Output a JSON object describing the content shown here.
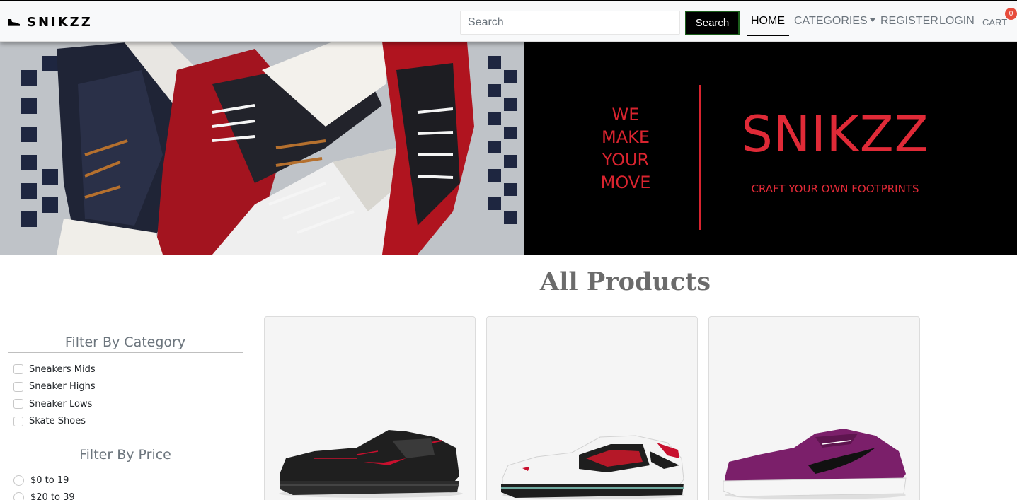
{
  "navbar": {
    "brand": "SNIKZZ",
    "search_placeholder": "Search",
    "search_button": "Search",
    "links": {
      "home": "HOME",
      "categories": "CATEGORIES",
      "register": "REGISTER",
      "login": "LOGIN",
      "cart": "CART"
    },
    "cart_count": "0"
  },
  "hero": {
    "tagline": [
      "WE",
      "MAKE",
      "YOUR",
      "MOVE"
    ],
    "brand": "SNIKZZ",
    "subtitle": "CRAFT YOUR OWN FOOTPRINTS",
    "accent_color": "#e02a37",
    "photo_icon": "sneaker-pile-photo"
  },
  "main": {
    "title": "All Products"
  },
  "filters": {
    "category_title": "Filter By Category",
    "categories": [
      "Sneakers Mids",
      "Sneaker Highs",
      "Sneaker Lows",
      "Skate Shoes"
    ],
    "price_title": "Filter By Price",
    "prices": [
      "$0 to 19",
      "$20 to 39"
    ]
  },
  "products": [
    {
      "image": "black-red-sneaker",
      "colors": [
        "#1e1e1e",
        "#c8102e"
      ]
    },
    {
      "image": "white-red-black-sneaker",
      "colors": [
        "#ffffff",
        "#c8102e",
        "#1e1e1e"
      ]
    },
    {
      "image": "purple-sneaker",
      "colors": [
        "#7b1f6a",
        "#111111",
        "#ffffff"
      ]
    }
  ]
}
